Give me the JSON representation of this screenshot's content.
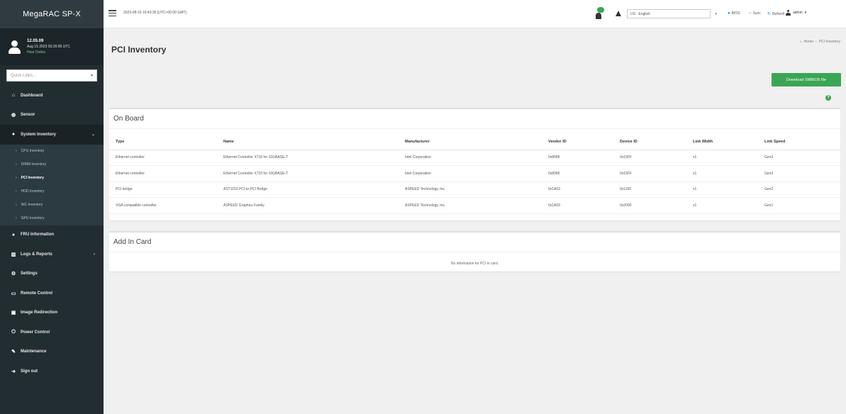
{
  "brand": "MegaRAC SP-X",
  "user": {
    "name": "12.05.09",
    "session": "Aug 15 2023 03:26:09 UTC",
    "status": "Host Online"
  },
  "quick_links": {
    "placeholder": "Quick Links...",
    "caret": "▾"
  },
  "sidebar": {
    "items": [
      {
        "label": "Dashboard",
        "icon": "home-icon",
        "glyph": "⌂"
      },
      {
        "label": "Sensor",
        "icon": "sensor-icon",
        "glyph": "◍"
      },
      {
        "label": "System Inventory",
        "icon": "inventory-icon",
        "glyph": "●",
        "arrow": "⌄"
      },
      {
        "label": "FRU Information",
        "icon": "info-icon",
        "glyph": "●"
      },
      {
        "label": "Logs & Reports",
        "icon": "chart-icon",
        "glyph": "▥",
        "arrow": "›"
      },
      {
        "label": "Settings",
        "icon": "gear-icon",
        "glyph": "⚙"
      },
      {
        "label": "Remote Control",
        "icon": "monitor-icon",
        "glyph": "▭"
      },
      {
        "label": "Image Redirection",
        "icon": "image-icon",
        "glyph": "▣"
      },
      {
        "label": "Power Control",
        "icon": "power-icon",
        "glyph": "⏻"
      },
      {
        "label": "Maintenance",
        "icon": "wrench-icon",
        "glyph": "✎"
      },
      {
        "label": "Sign out",
        "icon": "signout-icon",
        "glyph": "➜"
      }
    ],
    "subitems": [
      {
        "label": "CPU Inventory",
        "bullet": "›"
      },
      {
        "label": "DIMM Inventory",
        "bullet": "›"
      },
      {
        "label": "PCI Inventory",
        "bullet": "›"
      },
      {
        "label": "HDD Inventory",
        "bullet": "›"
      },
      {
        "label": "NIC Inventory",
        "bullet": "›"
      },
      {
        "label": "GPU Inventory",
        "bullet": "›"
      }
    ]
  },
  "topbar": {
    "datetime": "2023-08-15 16:43:35 [UTC+00:00 GMT]",
    "language": "US - English",
    "caret": "▾",
    "bios_label": "BIOS",
    "sync_label": "Sync",
    "refresh_label": "Refresh",
    "user_label": "admin",
    "dot": "●",
    "sync_glyph": "○",
    "refresh_glyph": "↻"
  },
  "page": {
    "title": "PCI Inventory",
    "breadcrumb_home": "Home",
    "breadcrumb_sep": "›",
    "breadcrumb_current": "PCI Inventory",
    "home_glyph": "⌂",
    "download_label": "Download SMBIOS file",
    "help_glyph": "?"
  },
  "onboard": {
    "title": "On Board",
    "columns": [
      "Type",
      "Name",
      "Manufacturer",
      "Vendor ID",
      "Device ID",
      "Link Width",
      "Link Speed"
    ],
    "rows": [
      [
        "Ethernet controller",
        "Ethernet Controller X710 for 10GBASE-T",
        "Intel Corporation",
        "0x8086",
        "0x15FF",
        "x1",
        "Gen3"
      ],
      [
        "Ethernet controller",
        "Ethernet Controller X710 for 10GBASE-T",
        "Intel Corporation",
        "0x8086",
        "0x15FF",
        "x1",
        "Gen3"
      ],
      [
        "PCI bridge",
        "AST1150 PCI-to-PCI Bridge",
        "ASPEED Technology, Inc.",
        "0x1A03",
        "0x1150",
        "x1",
        "Gen2"
      ],
      [
        "VGA compatible controller",
        "ASPEED Graphics Family",
        "ASPEED Technology, Inc.",
        "0x1A03",
        "0x2000",
        "x1",
        "Gen1"
      ]
    ]
  },
  "addin": {
    "title": "Add In Card",
    "empty_message": "No information for PCI in card."
  }
}
